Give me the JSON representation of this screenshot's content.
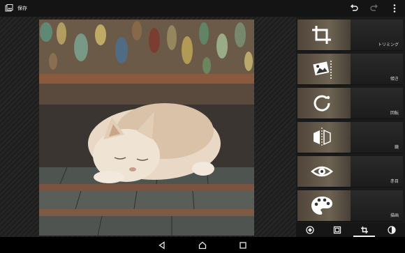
{
  "topbar": {
    "save_label": "保存"
  },
  "tools": [
    {
      "label": "トリミング",
      "icon": "crop-icon"
    },
    {
      "label": "傾き",
      "icon": "tilt-icon"
    },
    {
      "label": "回転",
      "icon": "rotate-icon"
    },
    {
      "label": "鏡",
      "icon": "mirror-icon"
    },
    {
      "label": "赤目",
      "icon": "red-eye-icon"
    },
    {
      "label": "描画",
      "icon": "palette-icon"
    }
  ],
  "colors": {
    "accent": "#f2f2f2",
    "background": "#1d1d1d"
  }
}
